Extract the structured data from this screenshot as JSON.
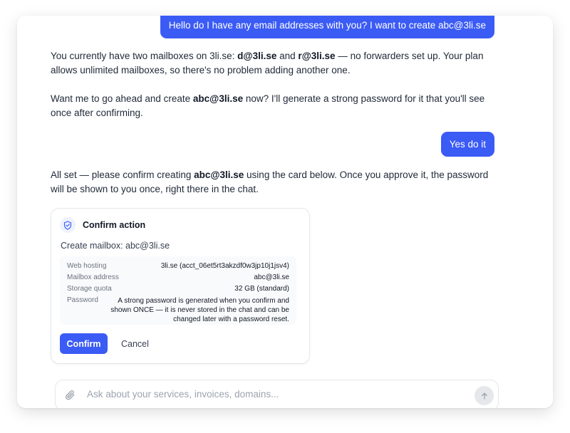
{
  "messages": [
    {
      "role": "user",
      "text": "Hello do I have any email addresses with you? I want to create abc@3li.se"
    },
    {
      "role": "assistant",
      "p1": {
        "a": "You currently have two mailboxes on 3li.se: ",
        "b1": "d@3li.se",
        "c": " and ",
        "b2": "r@3li.se",
        "d": " — no forwarders set up. Your plan allows unlimited mailboxes, so there's no problem adding another one."
      },
      "p2": {
        "a": "Want me to go ahead and create ",
        "b": "abc@3li.se",
        "c": " now? I'll generate a strong password for it that you'll see once after confirming."
      }
    },
    {
      "role": "user",
      "text": "Yes do it"
    },
    {
      "role": "assistant",
      "p1": {
        "a": "All set — please confirm creating ",
        "b": "abc@3li.se",
        "c": " using the card below. Once you approve it, the password will be shown to you once, right there in the chat."
      }
    }
  ],
  "card": {
    "icon": "shield-check-icon",
    "title": "Confirm action",
    "subtitle": "Create mailbox: abc@3li.se",
    "details": [
      {
        "key": "Web hosting",
        "value": "3li.se (acct_06et5rt3akzdf0w3jp10j1jsv4)"
      },
      {
        "key": "Mailbox address",
        "value": "abc@3li.se"
      },
      {
        "key": "Storage quota",
        "value": "32 GB (standard)"
      },
      {
        "key": "Password",
        "value": "A strong password is generated when you confirm and shown ONCE — it is never stored in the chat and can be changed later with a password reset."
      }
    ],
    "confirm_label": "Confirm",
    "cancel_label": "Cancel"
  },
  "composer": {
    "placeholder": "Ask about your services, invoices, domains...",
    "attach_icon": "paperclip-icon",
    "send_icon": "arrow-up-icon"
  },
  "colors": {
    "accent": "#3b5bf5",
    "text": "#1f2937",
    "muted": "#6b7280"
  }
}
